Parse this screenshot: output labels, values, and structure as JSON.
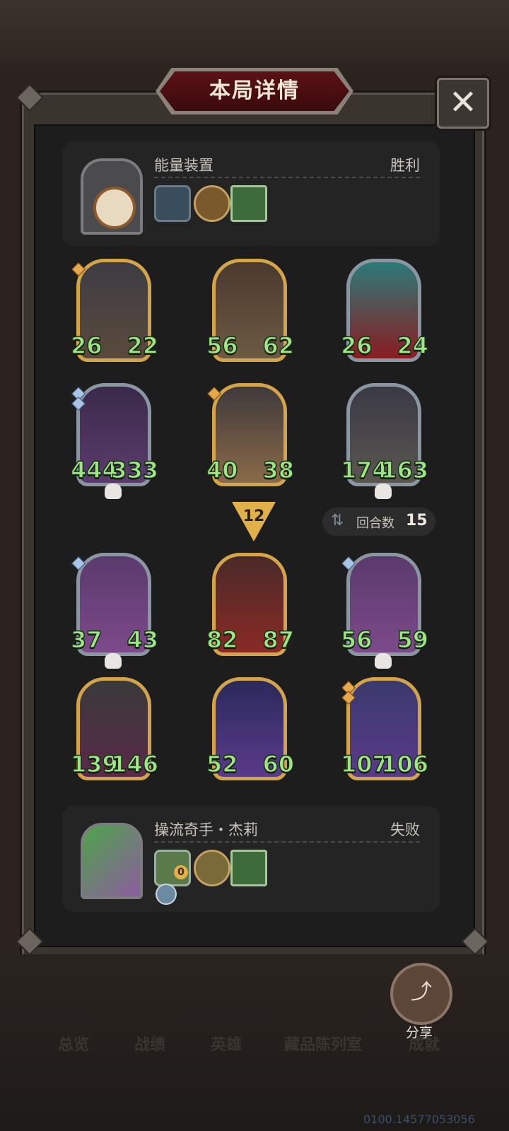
{
  "window_title": "本局详情",
  "close_icon": "close-x",
  "top_player": {
    "name": "能量装置",
    "result": "胜利",
    "portrait": "machine-portrait",
    "items": [
      "energy-device-icon",
      "clock-icon",
      "book-icon"
    ]
  },
  "top_board": [
    {
      "atk": "26",
      "hp": "22",
      "frame": "gold",
      "gems": 1
    },
    {
      "atk": "56",
      "hp": "62",
      "frame": "gold",
      "gems": 0
    },
    {
      "atk": "26",
      "hp": "24",
      "frame": "silver",
      "gems": 0
    },
    {
      "atk": "444",
      "hp": "333",
      "frame": "silver",
      "gems": 2,
      "skull": true
    },
    {
      "atk": "40",
      "hp": "38",
      "frame": "gold",
      "gems": 1
    },
    {
      "atk": "174",
      "hp": "163",
      "frame": "silver",
      "gems": 0,
      "skull": true
    }
  ],
  "round_marker": "12",
  "turn_info": {
    "label": "回合数",
    "count": "15"
  },
  "bottom_board": [
    {
      "atk": "37",
      "hp": "43",
      "frame": "silver",
      "gems": 1,
      "skull": true
    },
    {
      "atk": "82",
      "hp": "87",
      "frame": "gold",
      "gems": 0
    },
    {
      "atk": "56",
      "hp": "59",
      "frame": "silver",
      "gems": 1,
      "skull": true
    },
    {
      "atk": "139",
      "hp": "146",
      "frame": "gold",
      "gems": 0
    },
    {
      "atk": "52",
      "hp": "60",
      "frame": "gold",
      "gems": 0
    },
    {
      "atk": "107",
      "hp": "106",
      "frame": "gold",
      "gems": 2
    }
  ],
  "bottom_player": {
    "name": "操流奇手・杰莉",
    "result": "失败",
    "portrait": "girls-portrait",
    "items": [
      "hero-card-icon",
      "amulet-icon",
      "book-icon"
    ],
    "coin": "0"
  },
  "share": {
    "label": "分享",
    "icon": "share-icon"
  },
  "tabs": [
    "总览",
    "战绩",
    "英雄",
    "藏品陈列室",
    "成就"
  ],
  "version": "0100.14577053056",
  "colors": {
    "stat_green": "#9fe588",
    "gold_frame": "#d3a44a",
    "silver_frame": "#8a97a3",
    "title_red": "#5a1216"
  }
}
